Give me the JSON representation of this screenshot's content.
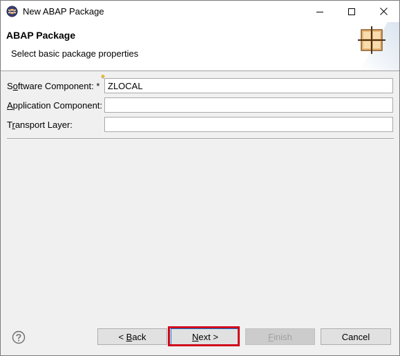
{
  "window": {
    "title": "New ABAP Package",
    "app_icon": "eclipse-icon",
    "controls": {
      "minimize_icon": "minimize-icon",
      "maximize_icon": "maximize-icon",
      "close_icon": "close-icon"
    }
  },
  "header": {
    "title": "ABAP Package",
    "subtitle": "Select basic package properties",
    "graphic_icon": "package-icon"
  },
  "form": {
    "software_component": {
      "label_prefix": "S",
      "label_underlined": "o",
      "label_suffix": "ftware Component: *",
      "value": "ZLOCAL",
      "required_marker_icon": "content-assist-bulb-icon"
    },
    "application_component": {
      "label_underlined": "A",
      "label_suffix": "pplication Component:",
      "value": ""
    },
    "transport_layer": {
      "label_prefix": "T",
      "label_underlined": "r",
      "label_suffix": "ansport Layer:",
      "value": ""
    }
  },
  "footer": {
    "help_icon": "help-icon",
    "back": {
      "prefix": "< ",
      "underlined": "B",
      "suffix": "ack"
    },
    "next": {
      "underlined": "N",
      "suffix": "ext >"
    },
    "finish": {
      "underlined": "F",
      "suffix": "inish"
    },
    "cancel": {
      "label": "Cancel"
    }
  },
  "colors": {
    "highlight": "#d0021b",
    "focus_border": "#0078d7",
    "disabled_text": "#a0a0a0"
  }
}
